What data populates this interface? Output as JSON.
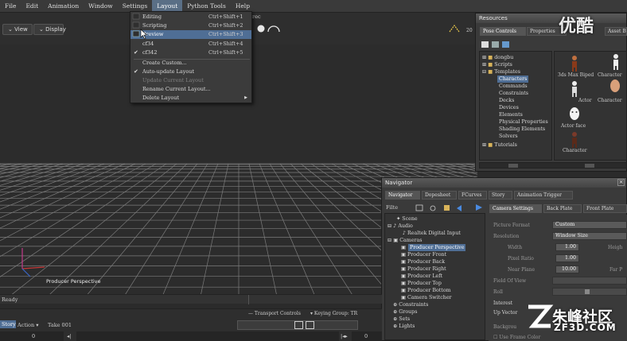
{
  "menu": {
    "items": [
      "File",
      "Edit",
      "Animation",
      "Window",
      "Settings",
      "Layout",
      "Python Tools",
      "Help"
    ],
    "active": "Layout"
  },
  "toolbar": {
    "view_label": "View",
    "display_label": "Display",
    "partial_text": "rec",
    "zoom_text": "20"
  },
  "layout_menu": {
    "items": [
      {
        "label": "Editing",
        "shortcut": "Ctrl+Shift+1"
      },
      {
        "label": "Scripting",
        "shortcut": "Ctrl+Shift+2"
      },
      {
        "label": "Preview",
        "shortcut": "Ctrl+Shift+3"
      },
      {
        "label": "cf34",
        "shortcut": "Ctrl+Shift+4"
      },
      {
        "label": "cf342",
        "shortcut": "Ctrl+Shift+5"
      },
      {
        "label": "Create Custom..."
      },
      {
        "label": "Auto-update Layout"
      },
      {
        "label": "Update Current Layout"
      },
      {
        "label": "Rename Current Layout..."
      },
      {
        "label": "Delete Layout"
      }
    ]
  },
  "viewport": {
    "camera_label": "Producer Perspective"
  },
  "resources": {
    "title": "Resources",
    "tabs": [
      "Pose Controls",
      "Properties",
      "Asset Browser"
    ],
    "tree": [
      "dongbu",
      "Scripts",
      "Templates",
      "Characters",
      "Commands",
      "Constraints",
      "Decks",
      "Devices",
      "Elements",
      "Physical Properties",
      "Shading Elements",
      "Solvers",
      "Tutorials"
    ],
    "selected": "Characters",
    "assets": [
      "3ds Max Biped",
      "Character",
      "Actor",
      "Character",
      "Actor face",
      "Character"
    ]
  },
  "navigator": {
    "title": "Navigator",
    "tabs": [
      "Navigator",
      "Dopesheet",
      "FCurves",
      "Story",
      "Animation Trigger"
    ],
    "filter_label": "Filte",
    "tree": [
      "Scene",
      "Audio",
      "Realtek Digital Input",
      "Cameras",
      "Producer Perspective",
      "Producer Front",
      "Producer Back",
      "Producer Right",
      "Producer Left",
      "Producer Top",
      "Producer Bottom",
      "Camera Switcher",
      "Constraints",
      "Groups",
      "Sets",
      "Lights"
    ],
    "selected": "Producer Perspective",
    "settings_tabs": [
      "Camera Settings",
      "Back Plate",
      "Front Plate"
    ],
    "fields": {
      "picture_format_label": "Picture Format",
      "picture_format": "Custom",
      "resolution_label": "Resolution",
      "resolution": "Window Size",
      "width_label": "Width",
      "width": "1.00",
      "height_label": "Heigh",
      "pixel_ratio_label": "Pixel Ratio",
      "pixel_ratio": "1.00",
      "near_plane_label": "Near Plane",
      "near_plane": "10.00",
      "far_label": "Far P",
      "field_of_view_label": "Field Of View",
      "roll_label": "Roll",
      "interest_label": "Interest",
      "up_vector_label": "Up Vector",
      "background_label": "Backgrou",
      "use_frame_color_label": "Use Frame Color"
    }
  },
  "status": {
    "text": "Ready"
  },
  "transport": {
    "label": "Transport Controls",
    "keying_label": "Keying Group: TR",
    "story_label": "Story",
    "action_label": "Action",
    "take_label": "Take 001",
    "frame_value": "0",
    "frame_value2": "0"
  },
  "watermarks": {
    "top_cn": "优酷",
    "brand_cn": "朱峰社区",
    "brand_en": "ZF3D.COM"
  },
  "colors": {
    "highlight": "#4f6e95",
    "grid": "#8a8a8a",
    "background": "#2b2b2b"
  }
}
